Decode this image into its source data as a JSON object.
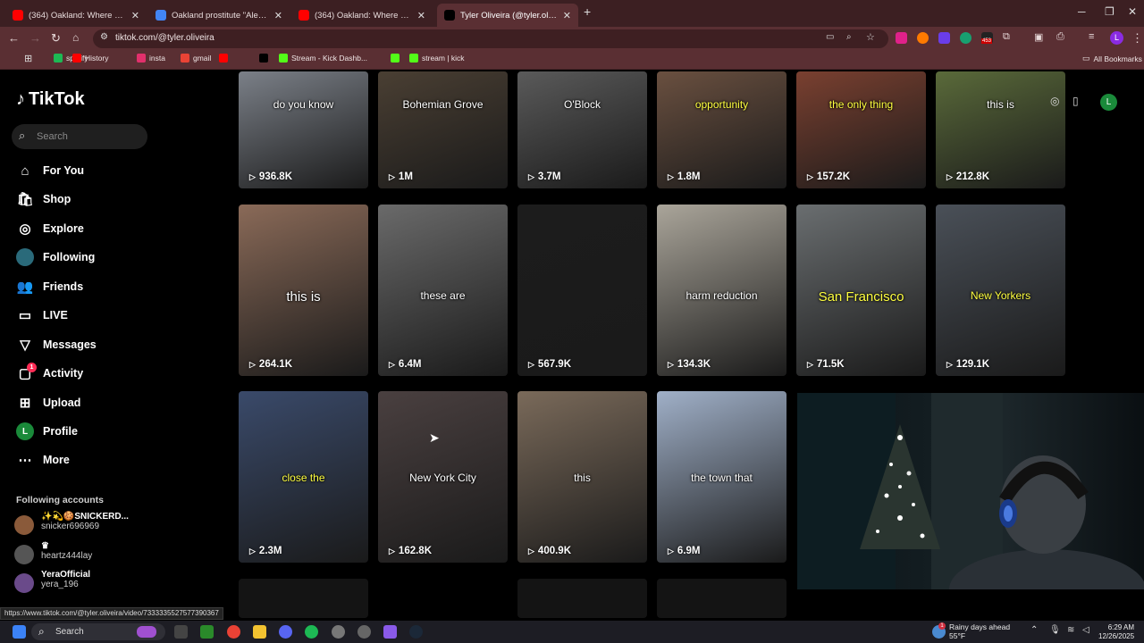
{
  "browser": {
    "tabs": [
      {
        "label": "(364) Oakland: Where Every Cri",
        "icon": "youtube-icon",
        "color": "#ff0000"
      },
      {
        "label": "Oakland prostitute \"Alexis\" - Go",
        "icon": "google-icon",
        "color": "#4285f4"
      },
      {
        "label": "(364) Oakland: Where Every Cri",
        "icon": "youtube-icon",
        "color": "#ff0000"
      },
      {
        "label": "Tyler Oliveira (@tyler.oliveira) |",
        "icon": "tiktok-icon",
        "color": "#000000"
      }
    ],
    "url": "tiktok.com/@tyler.oliveira",
    "bookmarks": [
      {
        "label": "spotify",
        "color": "#1db954"
      },
      {
        "label": "History",
        "color": "#ff0000"
      },
      {
        "label": "insta",
        "color": "#e1306c"
      },
      {
        "label": "gmail",
        "color": "#ea4335"
      },
      {
        "label": "",
        "color": "#ff0000"
      },
      {
        "label": "",
        "color": "#000000"
      },
      {
        "label": "Stream - Kick Dashb...",
        "color": "#53fc18"
      },
      {
        "label": "",
        "color": "#53fc18"
      },
      {
        "label": "stream | kick",
        "color": "#53fc18"
      }
    ],
    "all_bookmarks": "All Bookmarks",
    "extension_badge": "453",
    "profile_initial": "L"
  },
  "sidebar": {
    "logo": "TikTok",
    "search_placeholder": "Search",
    "nav": [
      {
        "label": "For You",
        "icon": "home-icon"
      },
      {
        "label": "Shop",
        "icon": "shop-icon"
      },
      {
        "label": "Explore",
        "icon": "compass-icon"
      },
      {
        "label": "Following",
        "icon": "following-avatar-icon"
      },
      {
        "label": "Friends",
        "icon": "friends-icon"
      },
      {
        "label": "LIVE",
        "icon": "live-icon"
      },
      {
        "label": "Messages",
        "icon": "messages-icon"
      },
      {
        "label": "Activity",
        "icon": "activity-icon",
        "badge": "1"
      },
      {
        "label": "Upload",
        "icon": "upload-icon"
      },
      {
        "label": "Profile",
        "icon": "profile-icon",
        "initial": "L"
      },
      {
        "label": "More",
        "icon": "more-icon"
      }
    ],
    "following_header": "Following accounts",
    "accounts": [
      {
        "name": "✨💫🍪SNICKERD...",
        "handle": "snicker696969"
      },
      {
        "name": "♛",
        "handle": "heartz444lay"
      },
      {
        "name": "YeraOfficial",
        "handle": "yera_196"
      }
    ]
  },
  "videos": [
    {
      "caption": "do you know",
      "views": "936.8K",
      "capColor": "#ffffff"
    },
    {
      "caption": "Bohemian Grove",
      "views": "1M",
      "capColor": "#ffffff"
    },
    {
      "caption": "O'Block",
      "views": "3.7M",
      "capColor": "#ffffff"
    },
    {
      "caption": "opportunity",
      "views": "1.8M",
      "capColor": "#ffff40"
    },
    {
      "caption": "the only thing",
      "views": "157.2K",
      "capColor": "#ffff40"
    },
    {
      "caption": "this is",
      "views": "212.8K",
      "capColor": "#ffffff"
    },
    {
      "caption": "this is",
      "views": "264.1K",
      "capColor": "#ffffff"
    },
    {
      "caption": "these are",
      "views": "6.4M",
      "capColor": "#ffffff"
    },
    {
      "caption": "",
      "views": "567.9K",
      "capColor": "#ffffff"
    },
    {
      "caption": "harm reduction",
      "views": "134.3K",
      "capColor": "#ffffff"
    },
    {
      "caption": "San Francisco",
      "views": "71.5K",
      "capColor": "#ffff40"
    },
    {
      "caption": "New Yorkers",
      "views": "129.1K",
      "capColor": "#ffff40"
    },
    {
      "caption": "close the",
      "views": "2.3M",
      "capColor": "#ffff40"
    },
    {
      "caption": "New York City",
      "views": "162.8K",
      "capColor": "#ffffff"
    },
    {
      "caption": "this",
      "views": "400.9K",
      "capColor": "#ffffff"
    },
    {
      "caption": "the town that",
      "views": "6.9M",
      "capColor": "#ffffff"
    }
  ],
  "status_url": "https://www.tiktok.com/@tyler.oliveira/video/7333335527577390367",
  "taskbar": {
    "search_placeholder": "Search",
    "weather_title": "Rainy days ahead",
    "weather_temp": "55°F",
    "weather_badge": "1",
    "time": "6:29 AM",
    "date": "12/26/2025"
  },
  "colors": {
    "browser_frame": "#3c1f22",
    "browser_toolbar": "#5a2f33",
    "tiktok_bg": "#000000",
    "accent_green": "#1db954"
  }
}
